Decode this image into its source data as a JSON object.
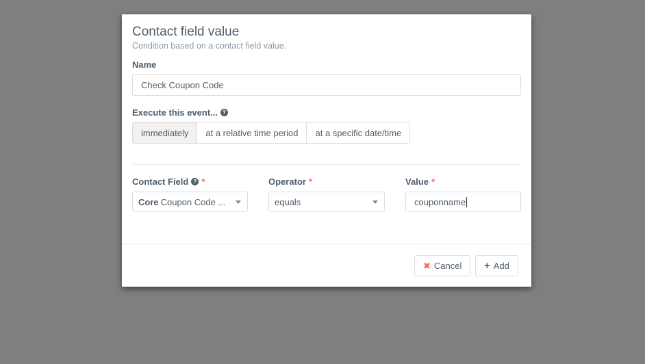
{
  "modal": {
    "title": "Contact field value",
    "subtitle": "Condition based on a contact field value."
  },
  "name_field": {
    "label": "Name",
    "value": "Check Coupon Code"
  },
  "execute": {
    "label": "Execute this event...",
    "options": [
      "immediately",
      "at a relative time period",
      "at a specific date/time"
    ],
    "selected": "immediately"
  },
  "contact_field": {
    "label": "Contact Field",
    "required_mark": "*",
    "group": "Core",
    "value": "Coupon Code ..."
  },
  "operator": {
    "label": "Operator",
    "required_mark": "*",
    "value": "equals"
  },
  "value_field": {
    "label": "Value",
    "required_mark": "*",
    "value": "couponname"
  },
  "footer": {
    "cancel_label": "Cancel",
    "add_label": "Add"
  },
  "colors": {
    "required": "#f86b4f",
    "cancel_icon": "#f86b4f",
    "overlay": "#7f7f7f"
  }
}
